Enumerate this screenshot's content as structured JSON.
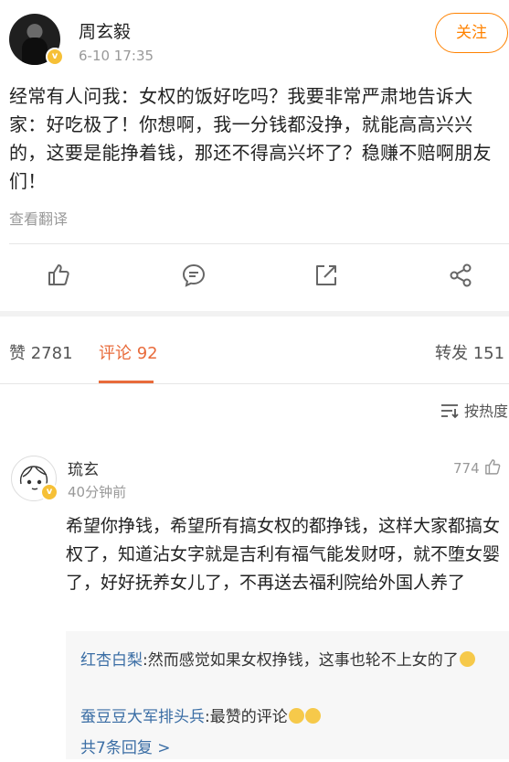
{
  "post": {
    "username": "周玄毅",
    "time": "6-10 17:35",
    "follow_label": "关注",
    "content": "经常有人问我：女权的饭好吃吗？我要非常严肃地告诉大家：好吃极了！你想啊，我一分钱都没挣，就能高高兴兴的，这要是能挣着钱，那还不得高兴坏了？稳赚不赔啊朋友们！",
    "translate_label": "查看翻译"
  },
  "tabs": {
    "likes": "赞 2781",
    "comments": "评论 92",
    "reposts": "转发 151"
  },
  "sort": {
    "label": "按热度"
  },
  "comment": {
    "username": "琉玄",
    "time": "40分钟前",
    "like_count": "774",
    "text": "希望你挣钱，希望所有搞女权的都挣钱，这样大家都搞女权了，知道沾女字就是吉利有福气能发财呀，就不堕女婴了，好好抚养女儿了，不再送去福利院给外国人养了",
    "replies": [
      {
        "name": "红杏白梨",
        "text": ":然而感觉如果女权挣钱，这事也轮不上女的了"
      },
      {
        "name": "蚕豆豆大军排头兵",
        "text": ":最赞的评论"
      }
    ],
    "more_replies": "共7条回复 >"
  },
  "colors": {
    "accent": "#ff8200",
    "active_tab": "#e86b3b",
    "link": "#3b6ea5"
  }
}
